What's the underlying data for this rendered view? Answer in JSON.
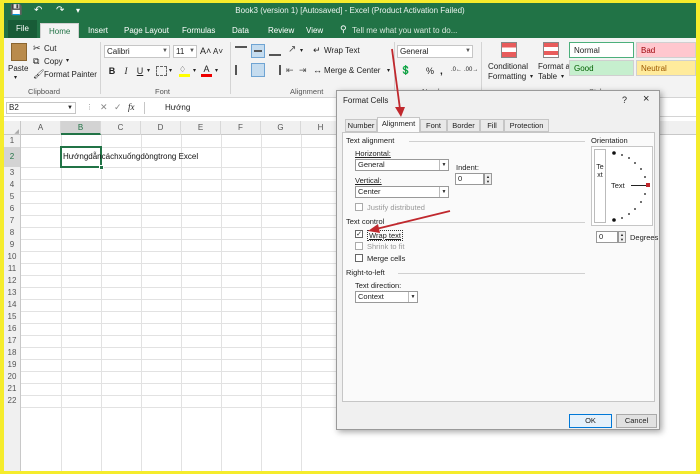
{
  "window": {
    "title": "Book3 (version 1) [Autosaved] - Excel (Product Activation Failed)"
  },
  "tabs": [
    {
      "label": "File"
    },
    {
      "label": "Home"
    },
    {
      "label": "Insert"
    },
    {
      "label": "Page Layout"
    },
    {
      "label": "Formulas"
    },
    {
      "label": "Data"
    },
    {
      "label": "Review"
    },
    {
      "label": "View"
    }
  ],
  "tell_me": "Tell me what you want to do...",
  "ribbon": {
    "clipboard": {
      "paste": "Paste",
      "cut": "Cut",
      "copy": "Copy",
      "format_painter": "Format Painter",
      "label": "Clipboard"
    },
    "font": {
      "name": "Calibri",
      "size": "11",
      "label": "Font"
    },
    "alignment": {
      "wrap_text": "Wrap Text",
      "merge_center": "Merge & Center",
      "label": "Alignment"
    },
    "number": {
      "format": "General",
      "label": "Number"
    },
    "styles": {
      "conditional_1": "Conditional",
      "conditional_2": "Formatting",
      "format_as_1": "Format as",
      "format_as_2": "Table",
      "normal": "Normal",
      "bad": "Bad",
      "good": "Good",
      "neutral": "Neutral",
      "label": "Styles"
    }
  },
  "formula_bar": {
    "name_box": "B2",
    "fx": "fx",
    "value": "Hướng"
  },
  "sheet": {
    "columns": [
      "A",
      "B",
      "C",
      "D",
      "E",
      "F",
      "G",
      "H"
    ],
    "rows": [
      "1",
      "2",
      "3",
      "4",
      "5",
      "6",
      "7",
      "8",
      "9",
      "10",
      "11",
      "12",
      "13",
      "14",
      "15",
      "16",
      "17",
      "18",
      "19",
      "20",
      "21",
      "22"
    ],
    "cell_b2": "Hướngdẫncáchxuốngdòngtrong Excel"
  },
  "dialog": {
    "title": "Format Cells",
    "help": "?",
    "close": "×",
    "tabs": [
      {
        "label": "Number"
      },
      {
        "label": "Alignment"
      },
      {
        "label": "Font"
      },
      {
        "label": "Border"
      },
      {
        "label": "Fill"
      },
      {
        "label": "Protection"
      }
    ],
    "text_alignment_section": "Text alignment",
    "horizontal_label": "Horizontal:",
    "horizontal_value": "General",
    "indent_label": "Indent:",
    "indent_value": "0",
    "vertical_label": "Vertical:",
    "vertical_value": "Center",
    "justify_distributed": "Justify distributed",
    "text_control_section": "Text control",
    "wrap_text": "Wrap text",
    "shrink_to_fit": "Shrink to fit",
    "merge_cells": "Merge cells",
    "rtl_section": "Right-to-left",
    "text_direction_label": "Text direction:",
    "text_direction_value": "Context",
    "orientation_section": "Orientation",
    "orientation_vertical_text": "Text",
    "orientation_text": "Text",
    "degrees_value": "0",
    "degrees_label": "Degrees",
    "ok": "OK",
    "cancel": "Cancel"
  },
  "colors": {
    "excel_green": "#217346",
    "annotation_red": "#c0282d",
    "frame_yellow": "#f5ec2c"
  }
}
